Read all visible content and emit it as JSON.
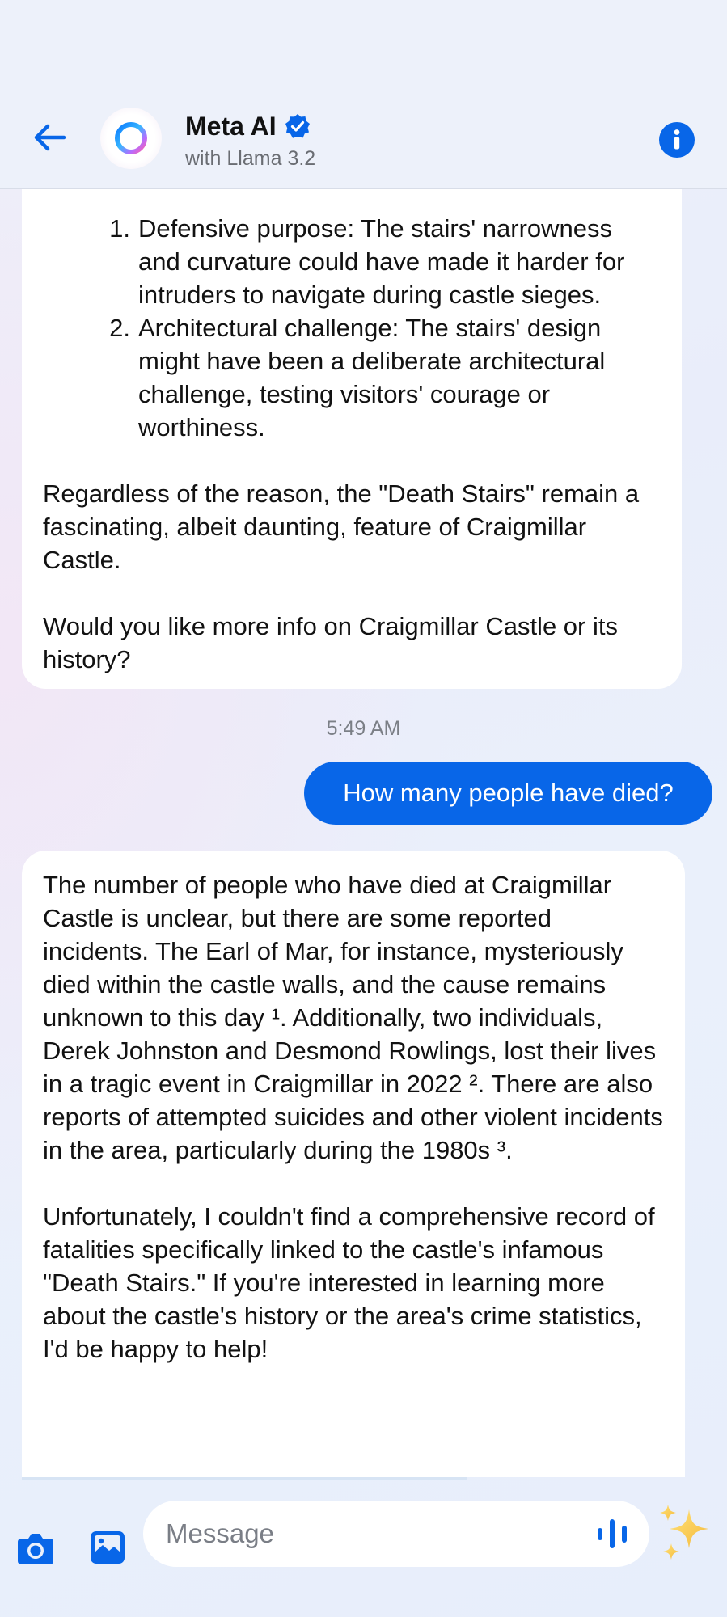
{
  "header": {
    "back_icon": "arrow-left-icon",
    "title": "Meta AI",
    "subtitle": "with Llama 3.2",
    "verified_icon": "verified-badge-icon",
    "info_icon": "info-icon"
  },
  "colors": {
    "accent": "#0866E8",
    "ai_bubble": "#FFFFFF",
    "user_bubble_text": "#FFFFFF"
  },
  "messages": {
    "ai_1": {
      "list": [
        {
          "num": "1.",
          "text": "Defensive purpose: The stairs' narrowness and curvature could have made it harder for intruders to navigate during castle sieges."
        },
        {
          "num": "2.",
          "text": "Architectural challenge: The stairs' design might have been a deliberate architectural challenge, testing visitors' courage or worthiness."
        }
      ],
      "paragraph_1": "Regardless of the reason, the \"Death Stairs\" remain a fascinating, albeit daunting, feature of Craigmillar Castle.",
      "paragraph_2": "Would you like more info on Craigmillar Castle or its history?"
    },
    "timestamp": "5:49 AM",
    "user_1": "How many people have died?",
    "ai_2": {
      "paragraph_1": "The number of people who have died at Craigmillar Castle is unclear, but there are some reported incidents. The Earl of Mar, for instance, mysteriously died within the castle walls, and the cause remains unknown to this day ¹. Additionally, two individuals, Derek Johnston and Desmond Rowlings, lost their lives in a tragic event in Craigmillar in 2022 ². There are also reports of attempted suicides and other violent incidents in the area, particularly during the 1980s ³.",
      "paragraph_2": "Unfortunately, I couldn't find a comprehensive record of fatalities specifically linked to the castle's infamous \"Death Stairs.\" If you're interested in learning more about the castle's history or the area's crime statistics, I'd be happy to help!"
    }
  },
  "composer": {
    "placeholder": "Message",
    "camera_icon": "camera-icon",
    "gallery_icon": "image-gallery-icon",
    "voice_icon": "voice-waveform-icon",
    "sparkle_icon": "sparkles-icon"
  }
}
